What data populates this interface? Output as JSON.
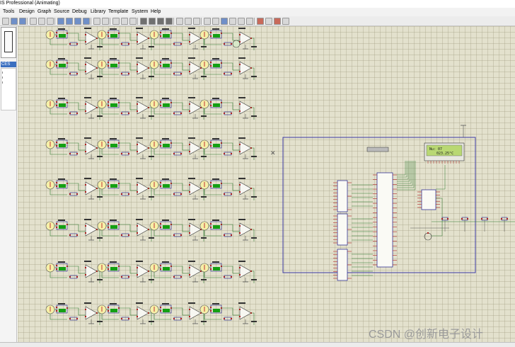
{
  "window": {
    "title": "IS Professional (Animating)"
  },
  "menu": {
    "items": [
      "Tools",
      "Design",
      "Graph",
      "Source",
      "Debug",
      "Library",
      "Template",
      "System",
      "Help"
    ]
  },
  "left_panel": {
    "devices_label": "CES"
  },
  "lcd": {
    "line1": "Nu: 07",
    "line2": "023.25°C"
  },
  "watermark": "CSDN @创新电子设计",
  "colors": {
    "grid_background": "#e3e1cd",
    "wire": "#2f7a2f",
    "component": "#1a1a8a",
    "pin": "#b02020",
    "sensor_fill": "#f6f0a8",
    "selection_box": "#3c3ca8",
    "lcd_screen": "#b9d873",
    "display_green": "#13a013"
  }
}
